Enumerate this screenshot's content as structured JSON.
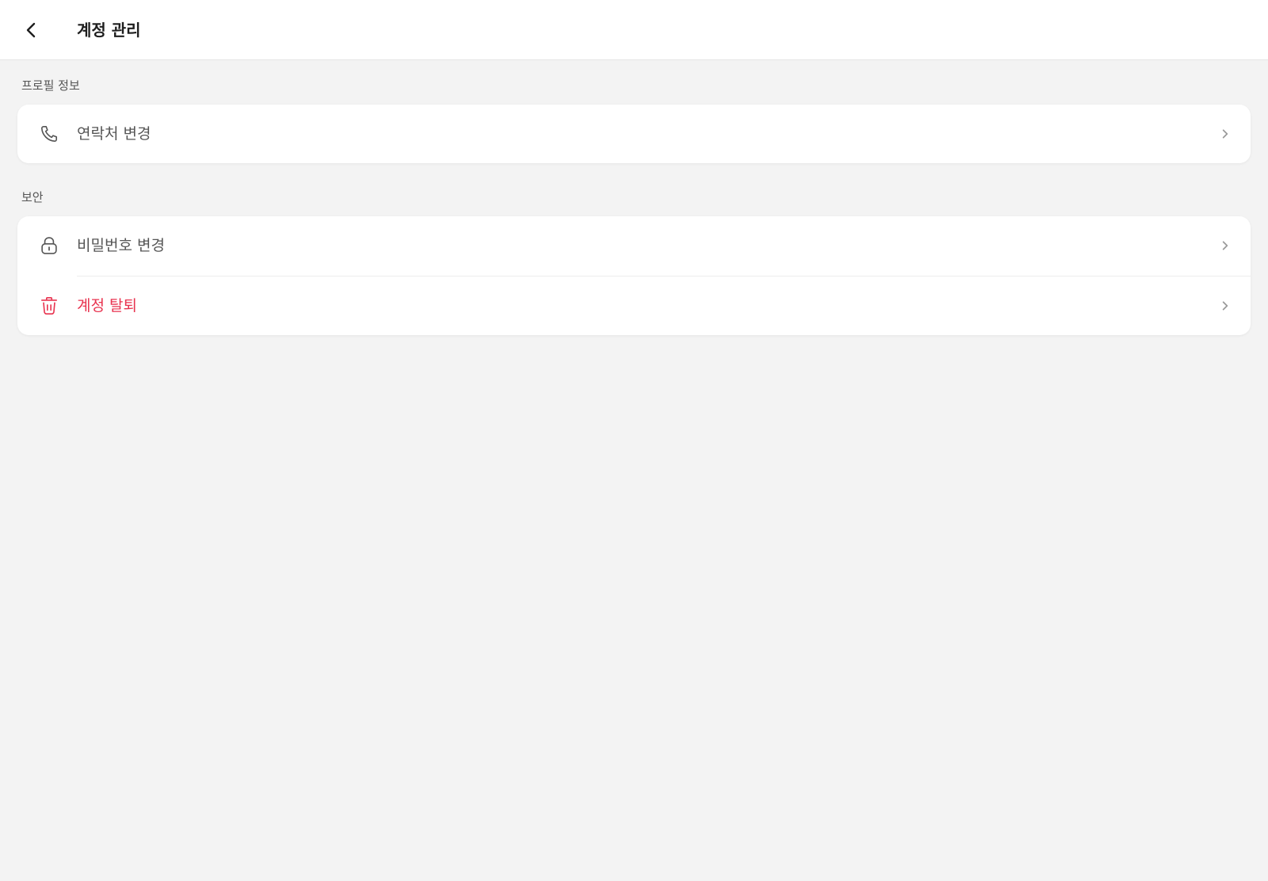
{
  "header": {
    "title": "계정 관리",
    "back_icon": "chevron-left-icon"
  },
  "sections": [
    {
      "label": "프로필 정보",
      "items": [
        {
          "label": "연락처 변경",
          "icon": "phone-icon"
        }
      ]
    },
    {
      "label": "보안",
      "items": [
        {
          "label": "비밀번호 변경",
          "icon": "lock-icon"
        },
        {
          "label": "계정 탈퇴",
          "icon": "trash-icon"
        }
      ]
    }
  ],
  "colors": {
    "background": "#f3f3f3",
    "card": "#ffffff",
    "text": "#555555",
    "title": "#1e1e1e",
    "danger": "#e8334f",
    "chevron": "#9a9a9a"
  }
}
